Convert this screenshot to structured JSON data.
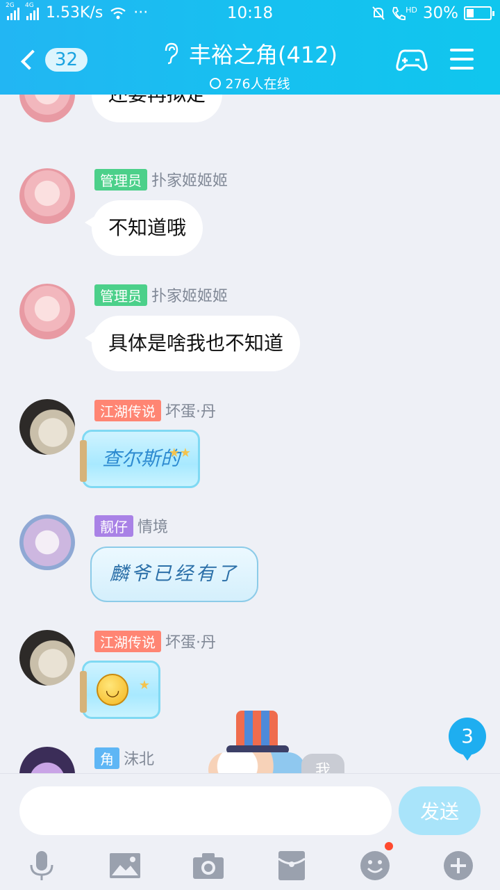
{
  "status_bar": {
    "net_2g": "2G",
    "net_4g": "4G",
    "speed": "1.53K/s",
    "more": "···",
    "time": "10:18",
    "hd": "HD",
    "battery": "30%",
    "battery_level": 0.3
  },
  "header": {
    "back_count": "32",
    "title": "丰裕之角(412)",
    "online": "276人在线",
    "icons": [
      "back-chevron-icon",
      "ear-icon",
      "game-controller-icon",
      "menu-icon"
    ]
  },
  "messages": [
    {
      "text": "还要再拟定"
    },
    {
      "badge": "管理员",
      "name": "扑家姬姬姬",
      "text": "不知道哦"
    },
    {
      "badge": "管理员",
      "name": "扑家姬姬姬",
      "text": "具体是啥我也不知道"
    },
    {
      "badge": "江湖传说",
      "name": "坏蛋·丹",
      "text": "查尔斯的"
    },
    {
      "badge": "靓仔",
      "name": "情境",
      "text": "麟爷已经有了"
    },
    {
      "badge": "江湖传说",
      "name": "坏蛋·丹",
      "emoji": "smiley-face"
    },
    {
      "badge": "角",
      "name": "沫北"
    }
  ],
  "new_messages": "3",
  "me_tag": "我",
  "input": {
    "value": "",
    "send_label": "发送"
  },
  "toolbar": [
    "microphone-icon",
    "image-icon",
    "camera-icon",
    "red-packet-icon",
    "emoji-icon",
    "plus-icon"
  ],
  "colors": {
    "header": "#1ab8f2",
    "badge_admin": "#4cd08a",
    "badge_legend": "#ff8573",
    "badge_handsome": "#a982e6",
    "badge_corner": "#5eb6f5",
    "send_button": "#a9e4fa"
  }
}
